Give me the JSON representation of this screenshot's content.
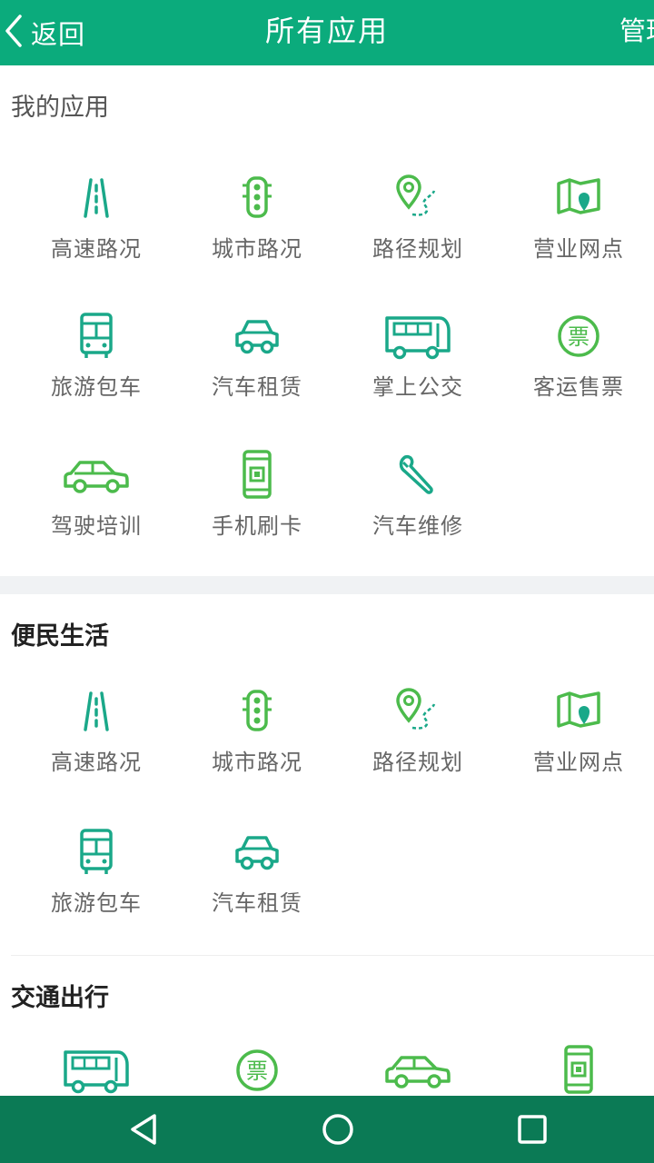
{
  "header": {
    "back_label": "返回",
    "title": "所有应用",
    "manage_label": "管理"
  },
  "colors": {
    "header_bg": "#0bab7c",
    "nav_bg": "#0b7a55",
    "teal": "#1aa889",
    "green": "#4cbb4c"
  },
  "sections": {
    "my_apps": {
      "title": "我的应用",
      "items": [
        {
          "label": "高速路况",
          "icon": "highway-icon"
        },
        {
          "label": "城市路况",
          "icon": "traffic-light-icon"
        },
        {
          "label": "路径规划",
          "icon": "route-pin-icon"
        },
        {
          "label": "营业网点",
          "icon": "map-pin-icon"
        },
        {
          "label": "旅游包车",
          "icon": "bus-icon"
        },
        {
          "label": "汽车租赁",
          "icon": "car-icon"
        },
        {
          "label": "掌上公交",
          "icon": "coach-icon"
        },
        {
          "label": "客运售票",
          "icon": "ticket-icon"
        },
        {
          "label": "驾驶培训",
          "icon": "sedan-icon"
        },
        {
          "label": "手机刷卡",
          "icon": "phone-card-icon"
        },
        {
          "label": "汽车维修",
          "icon": "wrench-icon"
        }
      ]
    },
    "convenience": {
      "title": "便民生活",
      "items": [
        {
          "label": "高速路况",
          "icon": "highway-icon"
        },
        {
          "label": "城市路况",
          "icon": "traffic-light-icon"
        },
        {
          "label": "路径规划",
          "icon": "route-pin-icon"
        },
        {
          "label": "营业网点",
          "icon": "map-pin-icon"
        },
        {
          "label": "旅游包车",
          "icon": "bus-icon"
        },
        {
          "label": "汽车租赁",
          "icon": "car-icon"
        }
      ]
    },
    "transport": {
      "title": "交通出行",
      "items": [
        {
          "icon": "coach-icon"
        },
        {
          "icon": "ticket-icon"
        },
        {
          "icon": "sedan-icon"
        },
        {
          "icon": "phone-card-icon"
        }
      ]
    }
  },
  "ticket_glyph": "票"
}
